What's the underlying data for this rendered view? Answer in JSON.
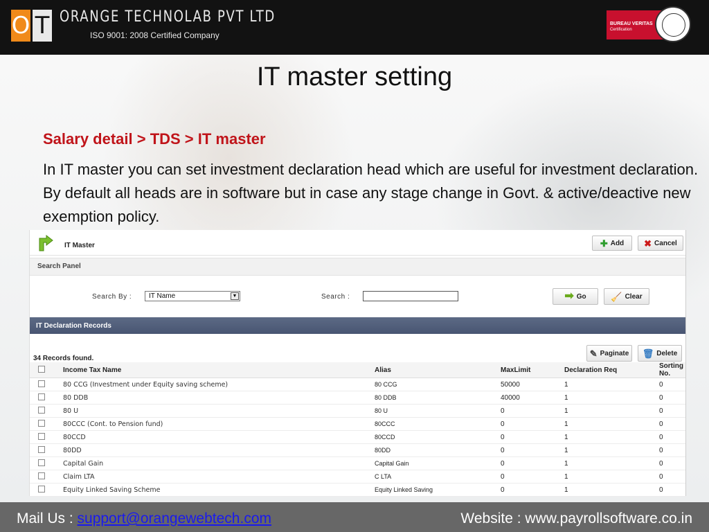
{
  "header": {
    "logo_o": "O",
    "logo_t": "T",
    "company": "ORANGE TECHNOLAB PVT LTD",
    "iso": "ISO 9001: 2008 Certified Company",
    "cert_line1": "BUREAU VERITAS",
    "cert_line2": "Certification",
    "brand_color": "#f08a1a",
    "cert_color": "#c8102e"
  },
  "slide": {
    "title": "IT master setting",
    "breadcrumb": "Salary detail > TDS > IT master",
    "paragraph": "In IT master you can set investment declaration head which are useful for investment declaration. By default all heads are in software but in case any stage change in Govt.  & active/deactive  new exemption policy."
  },
  "app": {
    "title": "IT Master",
    "add_label": "Add",
    "cancel_label": "Cancel",
    "search_panel": "Search Panel",
    "search_by_label": "Search By  :",
    "search_by_value": "IT Name",
    "search_label": "Search :",
    "go_label": "Go",
    "clear_label": "Clear",
    "records_header": "IT Declaration Records",
    "records_found": "34 Records found.",
    "paginate_label": "Paginate",
    "delete_label": "Delete",
    "columns": [
      "Income Tax Name",
      "Alias",
      "MaxLimit",
      "Declaration Req",
      "Sorting No."
    ],
    "rows": [
      [
        "80 CCG (Investment under Equity saving scheme)",
        "80 CCG",
        "50000",
        "1",
        "0"
      ],
      [
        "80 DDB",
        "80 DDB",
        "40000",
        "1",
        "0"
      ],
      [
        "80 U",
        "80 U",
        "0",
        "1",
        "0"
      ],
      [
        "80CCC (Cont. to Pension fund)",
        "80CCC",
        "0",
        "1",
        "0"
      ],
      [
        "80CCD",
        "80CCD",
        "0",
        "1",
        "0"
      ],
      [
        "80DD",
        "80DD",
        "0",
        "1",
        "0"
      ],
      [
        "Capital Gain",
        "Capital Gain",
        "0",
        "1",
        "0"
      ],
      [
        "Claim LTA",
        "C LTA",
        "0",
        "1",
        "0"
      ],
      [
        "Equity Linked Saving Scheme",
        "Equity Linked Saving",
        "0",
        "1",
        "0"
      ]
    ]
  },
  "footer": {
    "mail_label": "Mail Us : ",
    "mail": "support@orangewebtech.com",
    "website": "Website : www.payrollsoftware.co.in"
  }
}
